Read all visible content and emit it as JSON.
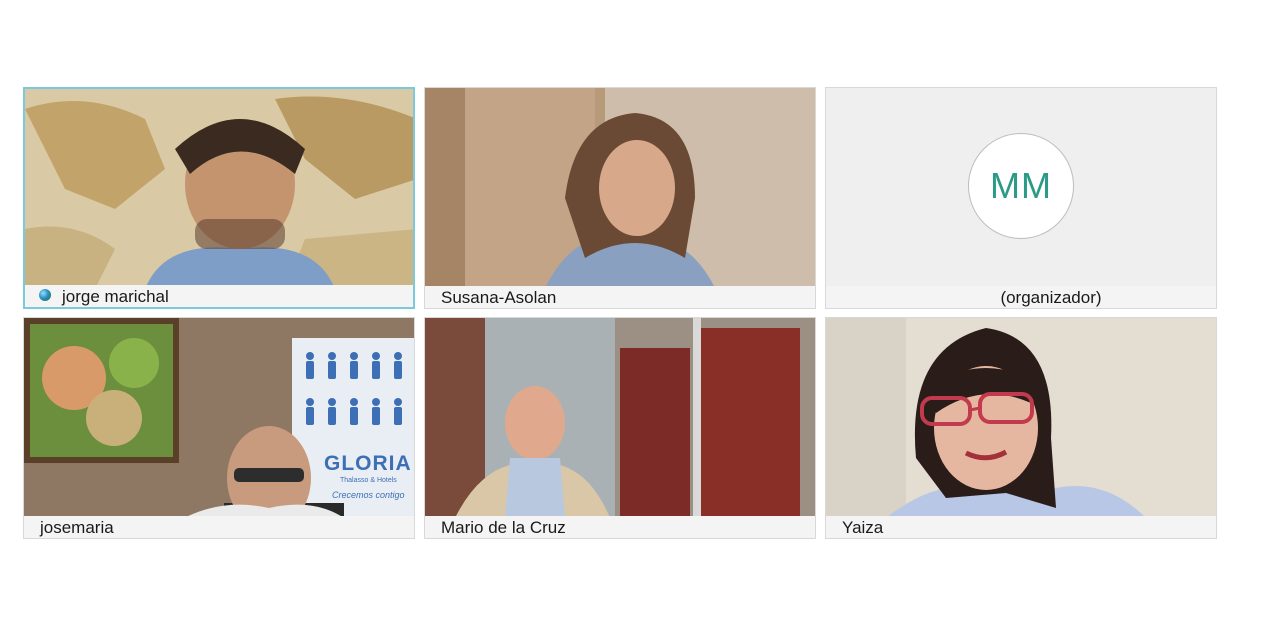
{
  "meeting": {
    "participants": [
      {
        "name": "jorge marichal",
        "speaking": true
      },
      {
        "name": "Susana-Asolan",
        "speaking": false
      },
      {
        "name": "(organizador)",
        "initials": "MM",
        "video": false
      },
      {
        "name": "josemaria",
        "speaking": false
      },
      {
        "name": "Mario de la Cruz",
        "speaking": false
      },
      {
        "name": "Yaiza",
        "speaking": false
      }
    ],
    "active_border_color": "#7cc8dc",
    "avatar_text_color": "#2b9a86",
    "banner": {
      "brand": "GLORIA",
      "subline": "Thalasso & Hotels",
      "slogan": "Crecemos contigo"
    }
  }
}
